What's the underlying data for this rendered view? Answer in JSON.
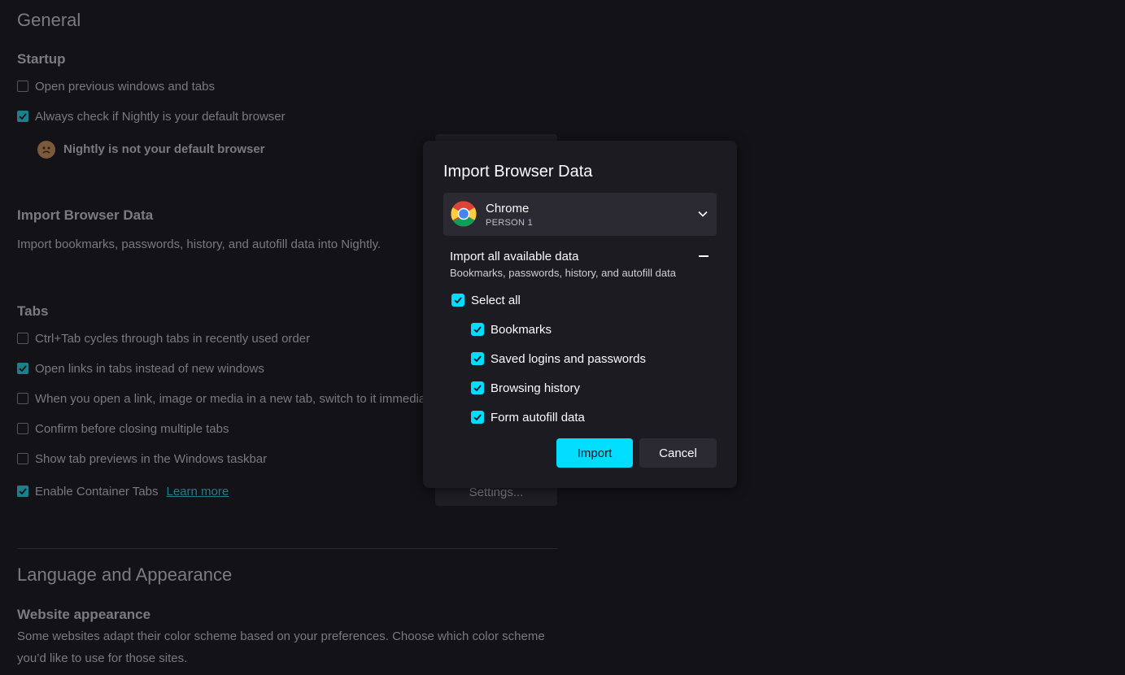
{
  "settings": {
    "general_heading": "General",
    "startup": {
      "heading": "Startup",
      "open_previous": "Open previous windows and tabs",
      "default_check": "Always check if Nightly is your default browser",
      "not_default": "Nightly is not your default browser"
    },
    "import": {
      "heading": "Import Browser Data",
      "description": "Import bookmarks, passwords, history, and autofill data into Nightly."
    },
    "tabs": {
      "heading": "Tabs",
      "ctrl_tab": "Ctrl+Tab cycles through tabs in recently used order",
      "open_links": "Open links in tabs instead of new windows",
      "switch_to": "When you open a link, image or media in a new tab, switch to it immedia",
      "confirm_close": "Confirm before closing multiple tabs",
      "taskbar_previews": "Show tab previews in the Windows taskbar",
      "container_tabs": "Enable Container Tabs",
      "learn_more": "Learn more",
      "settings_button": "Settings..."
    },
    "language_heading": "Language and Appearance",
    "appearance": {
      "heading": "Website appearance",
      "description_line1": "Some websites adapt their color scheme based on your preferences. Choose which color scheme",
      "description_line2": "you’d like to use for those sites."
    }
  },
  "dialog": {
    "title": "Import Browser Data",
    "browser": "Chrome",
    "profile": "PERSON 1",
    "section_title": "Import all available data",
    "section_subtitle": "Bookmarks, passwords, history, and autofill data",
    "select_all": "Select all",
    "items": [
      "Bookmarks",
      "Saved logins and passwords",
      "Browsing history",
      "Form autofill data"
    ],
    "import_button": "Import",
    "cancel_button": "Cancel"
  },
  "colors": {
    "accent": "#00ddff",
    "dialog_bg": "#1c1b22",
    "page_bg": "#131217"
  },
  "icons": [
    "chrome-logo-icon",
    "chevron-down-icon",
    "collapse-icon",
    "checkmark-icon",
    "sad-face-icon"
  ]
}
